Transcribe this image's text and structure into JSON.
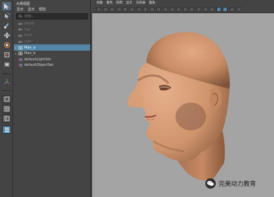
{
  "outliner": {
    "title": "大纲视图",
    "menu": [
      "显示",
      "显示",
      "帮助"
    ],
    "search_placeholder": "搜索...",
    "items": [
      {
        "label": "persp",
        "dim": true,
        "expand": "",
        "selected": false,
        "type": "camera"
      },
      {
        "label": "top",
        "dim": true,
        "expand": "",
        "selected": false,
        "type": "camera"
      },
      {
        "label": "front",
        "dim": true,
        "expand": "",
        "selected": false,
        "type": "camera"
      },
      {
        "label": "side",
        "dim": true,
        "expand": "",
        "selected": false,
        "type": "camera"
      },
      {
        "label": "Man_a",
        "dim": false,
        "expand": "▸",
        "selected": true,
        "type": "mesh"
      },
      {
        "label": "Man_b",
        "dim": false,
        "expand": "▸",
        "selected": false,
        "type": "mesh"
      },
      {
        "label": "defaultLightSet",
        "dim": false,
        "expand": "",
        "selected": false,
        "type": "set"
      },
      {
        "label": "defaultObjectSet",
        "dim": false,
        "expand": "",
        "selected": false,
        "type": "set"
      }
    ]
  },
  "viewport": {
    "menu": [
      "视图",
      "着色",
      "照明",
      "显示",
      "渲染器",
      "面板"
    ]
  },
  "watermark": {
    "text": "完美动力教育"
  },
  "colors": {
    "selection": "#5285a6",
    "viewport_bg": "#a3a3a3",
    "panel_bg": "#444444",
    "skin": "#c98d66"
  }
}
